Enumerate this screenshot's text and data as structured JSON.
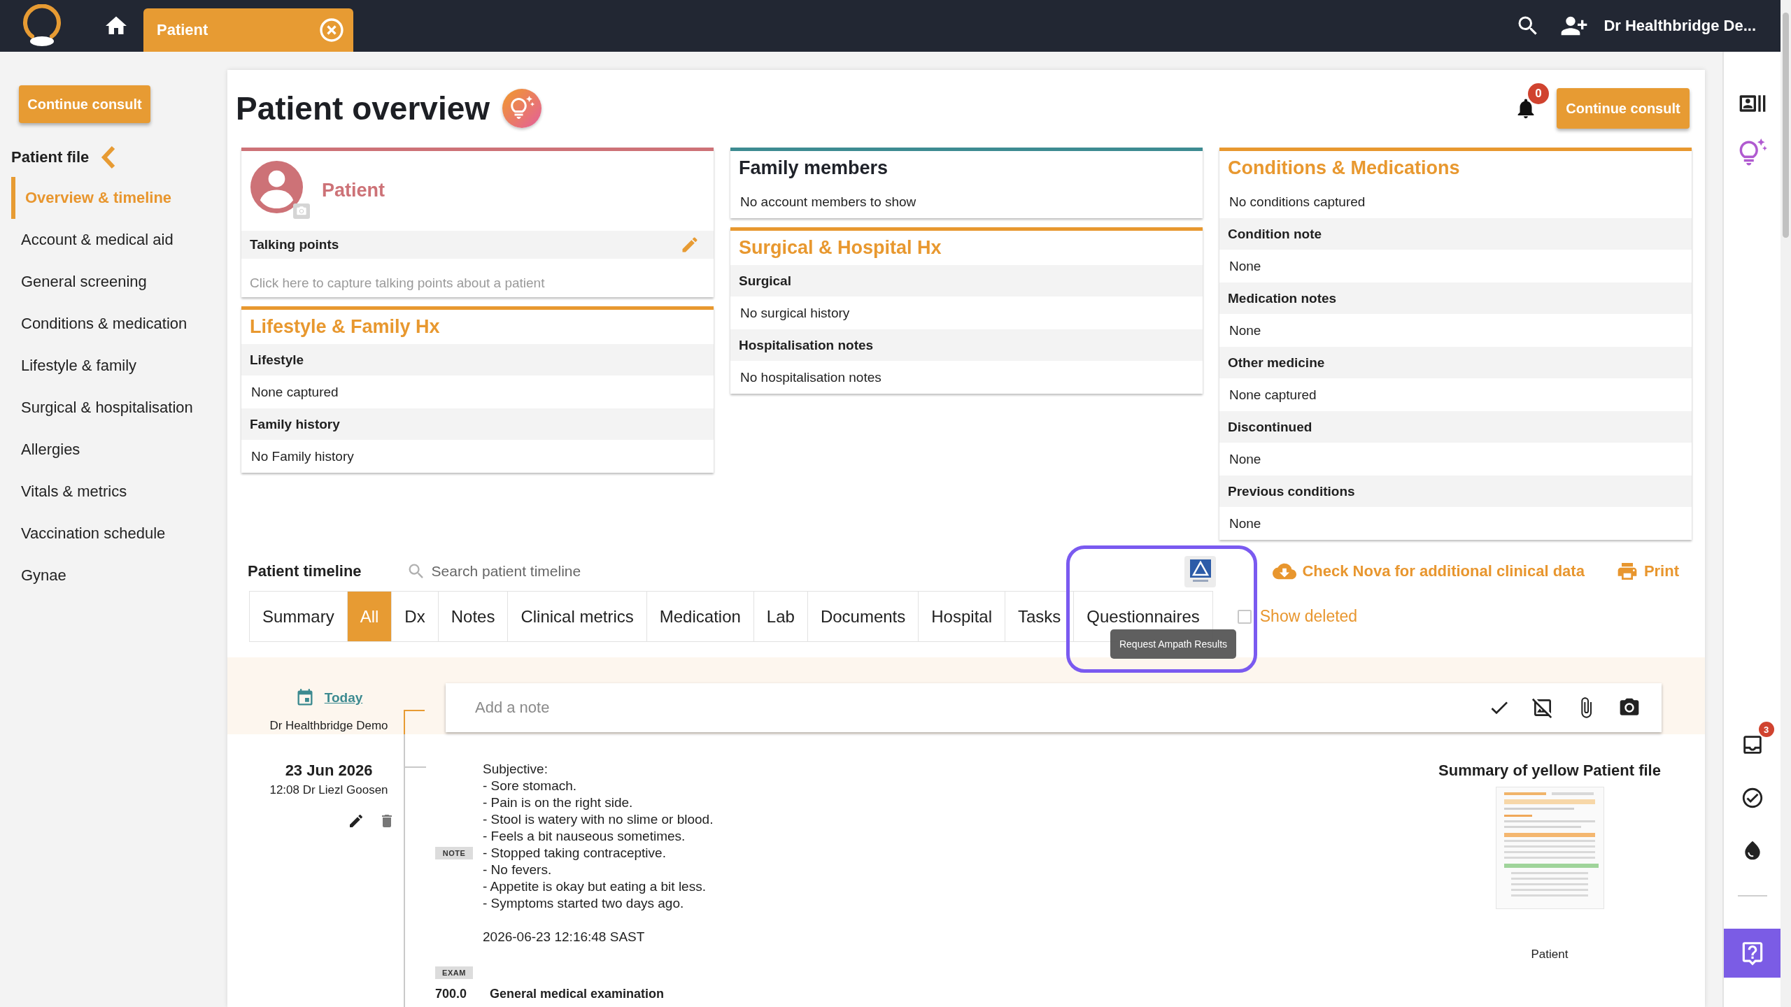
{
  "top_bar": {
    "tab": {
      "label": "Patient"
    },
    "user": "Dr Healthbridge De..."
  },
  "sidebar": {
    "button": "Continue consult",
    "heading": "Patient file",
    "items": [
      {
        "label": "Overview & timeline",
        "selected": true
      },
      {
        "label": "Account & medical aid",
        "selected": false
      },
      {
        "label": "General screening",
        "selected": false
      },
      {
        "label": "Conditions & medication",
        "selected": false
      },
      {
        "label": "Lifestyle & family",
        "selected": false
      },
      {
        "label": "Surgical & hospitalisation",
        "selected": false
      },
      {
        "label": "Allergies",
        "selected": false
      },
      {
        "label": "Vitals & metrics",
        "selected": false
      },
      {
        "label": "Vaccination schedule",
        "selected": false
      },
      {
        "label": "Gynae",
        "selected": false
      }
    ]
  },
  "header": {
    "title": "Patient overview",
    "notification_count": "0",
    "button": "Continue consult"
  },
  "columns": [
    {
      "cards": [
        {
          "kind": "profile",
          "color": "#cd7277",
          "name": "Patient",
          "section": "Talking points",
          "placeholder": "Click here to capture talking points about a patient"
        },
        {
          "kind": "section",
          "color": "#e8982f",
          "title": "Lifestyle & Family Hx",
          "rows": [
            {
              "kind": "label",
              "text": "Lifestyle"
            },
            {
              "kind": "value",
              "text": "None captured"
            },
            {
              "kind": "label",
              "text": "Family history"
            },
            {
              "kind": "value",
              "text": "No Family history"
            }
          ]
        }
      ]
    },
    {
      "cards": [
        {
          "kind": "plain",
          "color": "#3d8b91",
          "title": "Family members",
          "rows": [
            {
              "kind": "value",
              "text": "No account members to show"
            }
          ]
        },
        {
          "kind": "section",
          "color": "#e8982f",
          "title": "Surgical & Hospital Hx",
          "rows": [
            {
              "kind": "label",
              "text": "Surgical"
            },
            {
              "kind": "value",
              "text": "No surgical history"
            },
            {
              "kind": "label",
              "text": "Hospitalisation notes"
            },
            {
              "kind": "value",
              "text": "No hospitalisation notes"
            }
          ]
        }
      ]
    },
    {
      "cards": [
        {
          "kind": "section",
          "color": "#e8982f",
          "title": "Conditions & Medications",
          "rows": [
            {
              "kind": "value",
              "text": "No conditions captured"
            },
            {
              "kind": "label",
              "text": "Condition note"
            },
            {
              "kind": "value",
              "text": "None"
            },
            {
              "kind": "label",
              "text": "Medication notes"
            },
            {
              "kind": "value",
              "text": "None"
            },
            {
              "kind": "label",
              "text": "Other medicine"
            },
            {
              "kind": "value",
              "text": "None captured"
            },
            {
              "kind": "label",
              "text": "Discontinued"
            },
            {
              "kind": "value",
              "text": "None"
            },
            {
              "kind": "label",
              "text": "Previous conditions"
            },
            {
              "kind": "value",
              "text": "None"
            }
          ]
        }
      ]
    }
  ],
  "timeline": {
    "title": "Patient timeline",
    "search": {
      "placeholder": "Search patient timeline"
    },
    "tooltip": "Request Ampath Results",
    "nova_link": "Check Nova for additional clinical data",
    "print": "Print",
    "tabs": [
      {
        "label": "Summary",
        "selected": false
      },
      {
        "label": "All",
        "selected": true
      },
      {
        "label": "Dx",
        "selected": false
      },
      {
        "label": "Notes",
        "selected": false
      },
      {
        "label": "Clinical metrics",
        "selected": false
      },
      {
        "label": "Medication",
        "selected": false
      },
      {
        "label": "Lab",
        "selected": false
      },
      {
        "label": "Documents",
        "selected": false
      },
      {
        "label": "Hospital",
        "selected": false
      },
      {
        "label": "Tasks",
        "selected": false
      },
      {
        "label": "Questionnaires",
        "selected": false
      }
    ],
    "show_deleted": {
      "label": "Show deleted",
      "checked": false
    }
  },
  "composer": {
    "date_link": "Today",
    "author": "Dr Healthbridge Demo",
    "placeholder": "Add a note"
  },
  "entries": [
    {
      "date": "23 Jun 2026",
      "meta": "12:08 Dr Liezl Goosen",
      "blocks": [
        {
          "kind": "note",
          "tag": "NOTE",
          "lines": [
            "Subjective:",
            "- Sore stomach.",
            "- Pain is on the right side.",
            "- Stool is watery with no slime or blood.",
            "- Feels a bit nauseous sometimes.",
            "- Stopped taking contraceptive.",
            "- No fevers.",
            "- Appetite is okay but eating a bit less.",
            "- Symptoms started two days ago."
          ],
          "timestamp": "2026-06-23 12:16:48 SAST"
        },
        {
          "kind": "exam",
          "tag": "EXAM",
          "code": "700.0",
          "text": "General medical examination"
        }
      ],
      "attachment": {
        "title": "Summary of yellow Patient file",
        "caption": "Patient"
      }
    }
  ],
  "right_rail": {
    "inbox_count": "3"
  }
}
